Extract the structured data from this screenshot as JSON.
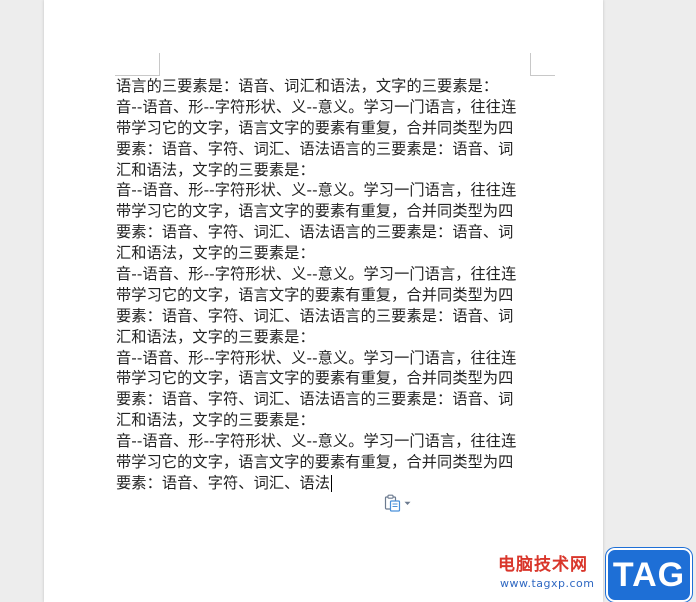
{
  "document": {
    "lines": [
      "语言的三要素是：语音、词汇和语法，文字的三要素是：",
      "音--语音、形--字符形状、义--意义。学习一门语言，往往连",
      "带学习它的文字，语言文字的要素有重复，合并同类型为四",
      "要素：语音、字符、词汇、语法语言的三要素是：语音、词",
      "汇和语法，文字的三要素是：",
      "音--语音、形--字符形状、义--意义。学习一门语言，往往连",
      "带学习它的文字，语言文字的要素有重复，合并同类型为四",
      "要素：语音、字符、词汇、语法语言的三要素是：语音、词",
      "汇和语法，文字的三要素是：",
      "音--语音、形--字符形状、义--意义。学习一门语言，往往连",
      "带学习它的文字，语言文字的要素有重复，合并同类型为四",
      "要素：语音、字符、词汇、语法语言的三要素是：语音、词",
      "汇和语法，文字的三要素是：",
      "音--语音、形--字符形状、义--意义。学习一门语言，往往连",
      "带学习它的文字，语言文字的要素有重复，合并同类型为四",
      "要素：语音、字符、词汇、语法语言的三要素是：语音、词",
      "汇和语法，文字的三要素是：",
      "音--语音、形--字符形状、义--意义。学习一门语言，往往连",
      "带学习它的文字，语言文字的要素有重复，合并同类型为四",
      "要素：语音、字符、词汇、语法"
    ]
  },
  "paste_options": {
    "icon": "clipboard-icon",
    "dropdown_icon": "caret-down-icon"
  },
  "watermark": {
    "title": "电脑技术网",
    "url": "www.tagxp.com",
    "badge": "TAG"
  },
  "colors": {
    "workspace_bg": "#ededed",
    "page_bg": "#ffffff",
    "text": "#222222",
    "watermark_red": "#d9362b",
    "watermark_blue": "#1e6fd6"
  }
}
